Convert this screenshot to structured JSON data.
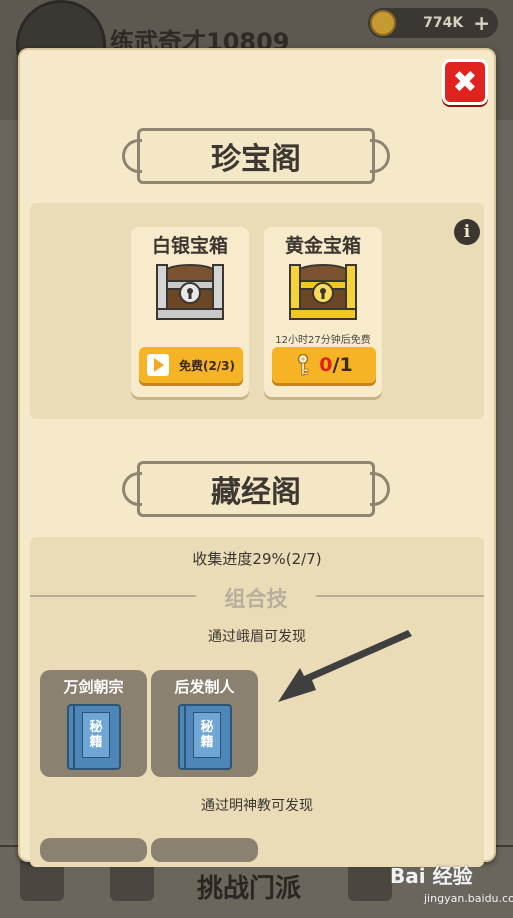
{
  "background": {
    "player_name": "练武奇才10809",
    "coins": "774K",
    "coin_plus": "+",
    "bottom_bar_title": "挑战门派"
  },
  "watermark": {
    "main": "Bai 经验",
    "sub": "jingyan.baidu.com"
  },
  "dialog": {
    "close_label": "✖",
    "treasure_section": {
      "title": "珍宝阁",
      "info_icon": "i",
      "chests": [
        {
          "name": "白银宝箱",
          "timer": "",
          "button_icon": "play-icon",
          "button_label": "免费(2/3)",
          "color": "#b8b8b8"
        },
        {
          "name": "黄金宝箱",
          "timer": "12小时27分钟后免费",
          "button_icon": "key-icon",
          "key_count": "0",
          "key_total": "/1",
          "color": "#f2c81e"
        }
      ]
    },
    "scripture_section": {
      "title": "藏经阁",
      "progress": "收集进度29%(2/7)",
      "combo_title": "组合技",
      "groups": [
        {
          "hint": "通过峨眉可发现",
          "books": [
            {
              "name": "万剑朝宗",
              "tag": [
                "秘",
                "籍"
              ]
            },
            {
              "name": "后发制人",
              "tag": [
                "秘",
                "籍"
              ]
            }
          ]
        },
        {
          "hint": "通过明神教可发现",
          "books": []
        }
      ]
    }
  },
  "colors": {
    "dialog_bg": "#f6e9c9",
    "button_yellow": "#f5b325",
    "close_red": "#e0231f",
    "book_blue": "#4d87b8"
  }
}
